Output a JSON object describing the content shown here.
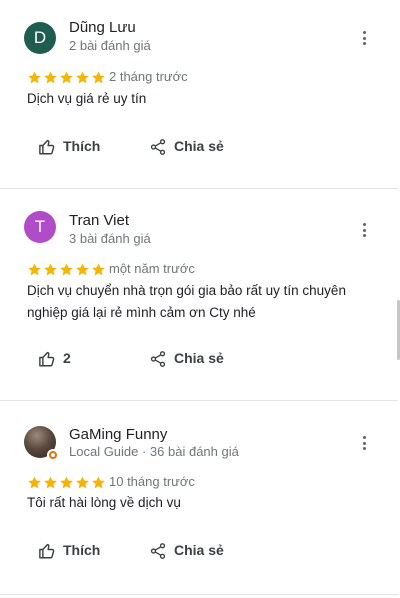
{
  "reviews": [
    {
      "name": "Dũng Lưu",
      "avatar_letter": "D",
      "avatar_color": "#1e5d4f",
      "meta": "2 bài đánh giá",
      "rating": 5,
      "time": "2 tháng trước",
      "text": "Dịch vụ giá rẻ uy tín",
      "like_label": "Thích",
      "share_label": "Chia sẻ"
    },
    {
      "name": "Tran Viet",
      "avatar_letter": "T",
      "avatar_color": "#b14cc8",
      "meta": "3 bài đánh giá",
      "rating": 5,
      "time": "một năm trước",
      "text": "Dịch vụ chuyển nhà trọn gói gia bảo rất uy tín chuyên nghiệp giá lại rẻ mình cảm ơn Cty nhé",
      "like_label": "2",
      "share_label": "Chia sẻ"
    },
    {
      "name": "GaMing Funny",
      "avatar_letter": "",
      "meta": "Local Guide · 36 bài đánh giá",
      "rating": 5,
      "time": "10 tháng trước",
      "text": "Tôi rất hài lòng về dịch vụ",
      "like_label": "Thích",
      "share_label": "Chia sẻ"
    }
  ],
  "colors": {
    "star": "#f6b400",
    "secondary_text": "#70757a",
    "divider": "#e3e3e3"
  },
  "icons": {
    "like": "thumb-up-icon",
    "share": "share-icon",
    "more": "more-vert-icon",
    "star": "star-icon",
    "local_guide": "local-guide-badge-icon"
  }
}
